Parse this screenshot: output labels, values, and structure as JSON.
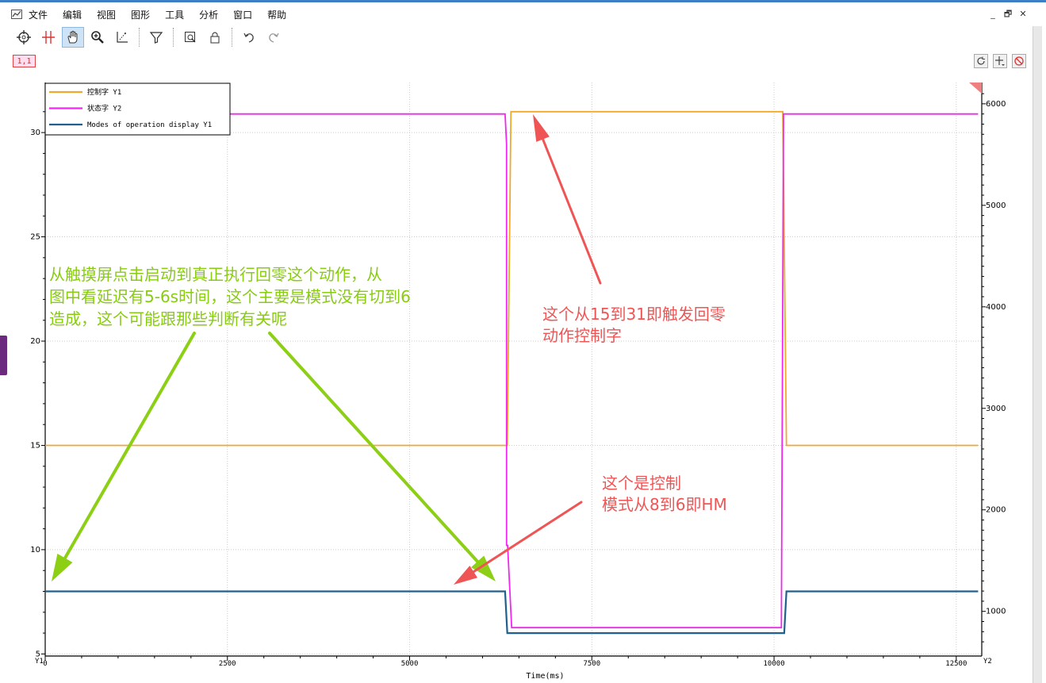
{
  "menu": [
    "文件",
    "编辑",
    "视图",
    "图形",
    "工具",
    "分析",
    "窗口",
    "帮助"
  ],
  "window_controls": [
    "_",
    "🗗",
    "✕"
  ],
  "toolbar": {
    "icons": [
      "crosshair-icon",
      "cursor-cross-icon",
      "hand-pan-icon",
      "zoom-icon",
      "axis-scale-icon",
      "filter-icon",
      "zoom-fit-icon",
      "lock-icon",
      "undo-icon",
      "redo-icon"
    ],
    "active": "hand-pan-icon"
  },
  "plot_tag": "1,1",
  "right_buttons": [
    "refresh-icon",
    "add-cursor-icon",
    "clear-icon"
  ],
  "chart_data": {
    "type": "line",
    "xlabel": "Time(ms)",
    "x_ticks": [
      0,
      2500,
      5000,
      7500,
      10000,
      12500
    ],
    "xlim": [
      0,
      12850
    ],
    "left_axis": {
      "label": "Y1",
      "ticks": [
        5,
        10,
        15,
        20,
        25,
        30
      ],
      "ylim": [
        4.9,
        32.4
      ]
    },
    "right_axis": {
      "label": "Y2",
      "ticks": [
        1000,
        2000,
        3000,
        4000,
        5000,
        6000
      ],
      "ylim": [
        560,
        6210
      ]
    },
    "grid": true,
    "legend_position": "top-left",
    "colors": {
      "控制字": "#f0a830",
      "状态字": "#f028ee",
      "mode": "#20608f"
    },
    "series": [
      {
        "name": "控制字 Y1",
        "axis": "Y1",
        "x": [
          0,
          6340,
          6390,
          10120,
          10170,
          12800
        ],
        "y": [
          15,
          15,
          31,
          31,
          15,
          15
        ]
      },
      {
        "name": "状态字 Y2",
        "axis": "Y2",
        "x": [
          0,
          6310,
          6330,
          6330,
          6345,
          6345,
          6400,
          10100,
          10130,
          12800
        ],
        "y": [
          5900,
          5900,
          5600,
          1650,
          1650,
          1650,
          840,
          840,
          5900,
          5900
        ]
      },
      {
        "name": "Modes of operation display Y1",
        "axis": "Y1",
        "x": [
          0,
          6310,
          6340,
          10140,
          10170,
          12800
        ],
        "y": [
          8,
          8,
          6,
          6,
          8,
          8
        ]
      }
    ],
    "annotations": [
      {
        "text_lines": [
          "从触摸屏点击启动到真正执行回零这个动作，从",
          "图中看延迟有5-6s时间，这个主要是模式没有切到6",
          "造成，这个可能跟那些判断有关呢"
        ],
        "color": "#88cc11"
      },
      {
        "text_lines": [
          "这个从15到31即触发回零",
          "动作控制字"
        ],
        "color": "#f05555"
      },
      {
        "text_lines": [
          "这个是控制",
          "模式从8到6即HM"
        ],
        "color": "#f05555"
      }
    ]
  }
}
